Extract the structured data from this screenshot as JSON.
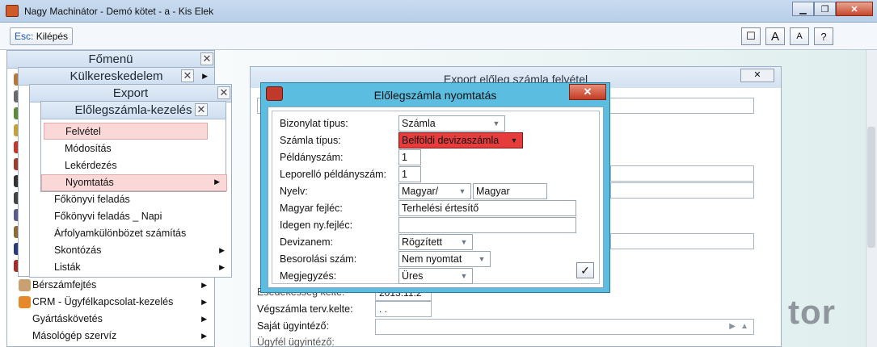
{
  "window": {
    "title": "Nagy Machinátor - Demó kötet - a - Kis Elek",
    "buttons": [
      "▁",
      "❐",
      "✕"
    ]
  },
  "toolbar": {
    "esc_key": "Esc:",
    "esc_label": "Kilépés",
    "right_buttons": [
      "☐",
      "A",
      "A",
      "?"
    ]
  },
  "watermark": "tor",
  "main_menu": {
    "title": "Főmenü",
    "items": [
      {
        "label": "Bérszámfejtés"
      },
      {
        "label": "CRM - Ügyfélkapcsolat-kezelés"
      },
      {
        "label": "Gyártáskövetés"
      },
      {
        "label": "Másológép szervíz"
      }
    ]
  },
  "kulker_menu": {
    "title": "Külkereskedelem"
  },
  "export_menu": {
    "title": "Export",
    "items": [
      {
        "label": "Főkönyvi feladás"
      },
      {
        "label": "Főkönyvi feladás _ Napi"
      },
      {
        "label": "Árfolyamkülönbözet számítás"
      },
      {
        "label": "Skontózás"
      },
      {
        "label": "Listák"
      }
    ]
  },
  "eloleg_menu": {
    "title": "Előlegszámla-kezelés",
    "items": [
      {
        "label": "Felvétel"
      },
      {
        "label": "Módosítás"
      },
      {
        "label": "Lekérdezés"
      },
      {
        "label": "Nyomtatás"
      }
    ]
  },
  "bg_form": {
    "title": "Export előleg számla felvétel",
    "close": "✕",
    "labels": {
      "partial": "Esedékesség kelte:",
      "partial_value": "2013.11.2",
      "vegszamla": "Végszámla terv.kelte:",
      "vegszamla_value": ".   .",
      "ugyintezo": "Saját ügyintéző:",
      "ugyfel": "Ügyfél ügyintéző:"
    }
  },
  "dialog": {
    "title": "Előlegszámla nyomtatás",
    "close": "✕",
    "fields": [
      {
        "label": "Bizonylat típus:",
        "value": "Számla"
      },
      {
        "label": "Számla típus:",
        "value": "Belföldi devizaszámla"
      },
      {
        "label": "Példányszám:",
        "value": "1"
      },
      {
        "label": "Leporelló példányszám:",
        "value": "1"
      },
      {
        "label": "Nyelv:",
        "value": "Magyar/",
        "extra": "Magyar"
      },
      {
        "label": "Magyar fejléc:",
        "value": "Terhelési értesítő"
      },
      {
        "label": "Idegen ny.fejléc:",
        "value": ""
      },
      {
        "label": "Devizanem:",
        "value": "Rögzített"
      },
      {
        "label": "Besorolási szám:",
        "value": "Nem nyomtat"
      },
      {
        "label": "Megjegyzés:",
        "value": "Üres"
      }
    ],
    "ok": "✓"
  }
}
